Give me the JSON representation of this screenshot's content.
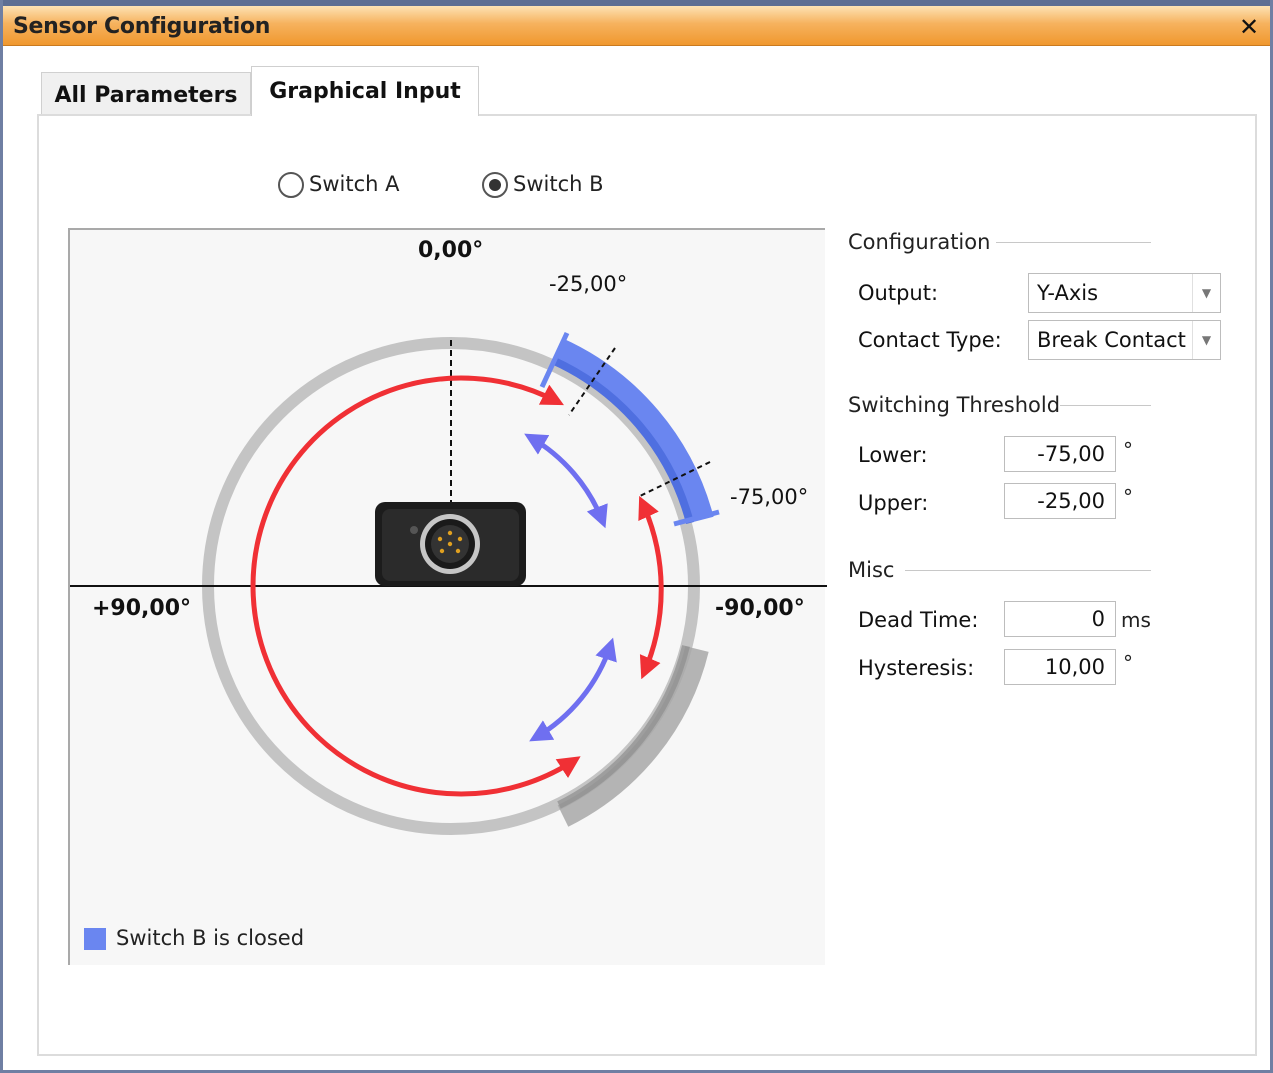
{
  "window": {
    "title": "Sensor Configuration",
    "close_glyph": "✕"
  },
  "tabs": [
    {
      "label": "All Parameters",
      "active": false
    },
    {
      "label": "Graphical Input",
      "active": true
    }
  ],
  "switches": [
    {
      "label": "Switch A",
      "selected": false
    },
    {
      "label": "Switch B",
      "selected": true
    }
  ],
  "diagram": {
    "top_label": "0,00°",
    "left_label": "+90,00°",
    "right_label": "-90,00°",
    "label_upper": "-25,00°",
    "label_lower": "-75,00°",
    "legend": "Switch B is closed",
    "colors": {
      "closed": "#6a86f0",
      "arrow_red": "#f03035",
      "arrow_blue": "#6f6ff0",
      "ring": "#c4c4c4"
    }
  },
  "configuration": {
    "title": "Configuration",
    "output_label": "Output:",
    "output_value": "Y-Axis",
    "contact_label": "Contact Type:",
    "contact_value": "Break Contact"
  },
  "threshold": {
    "title": "Switching Threshold",
    "lower_label": "Lower:",
    "lower_value": "-75,00",
    "upper_label": "Upper:",
    "upper_value": "-25,00",
    "unit": "°"
  },
  "misc": {
    "title": "Misc",
    "dead_time_label": "Dead Time:",
    "dead_time_value": "0",
    "dead_time_unit": "ms",
    "hysteresis_label": "Hysteresis:",
    "hysteresis_value": "10,00",
    "hysteresis_unit": "°"
  }
}
